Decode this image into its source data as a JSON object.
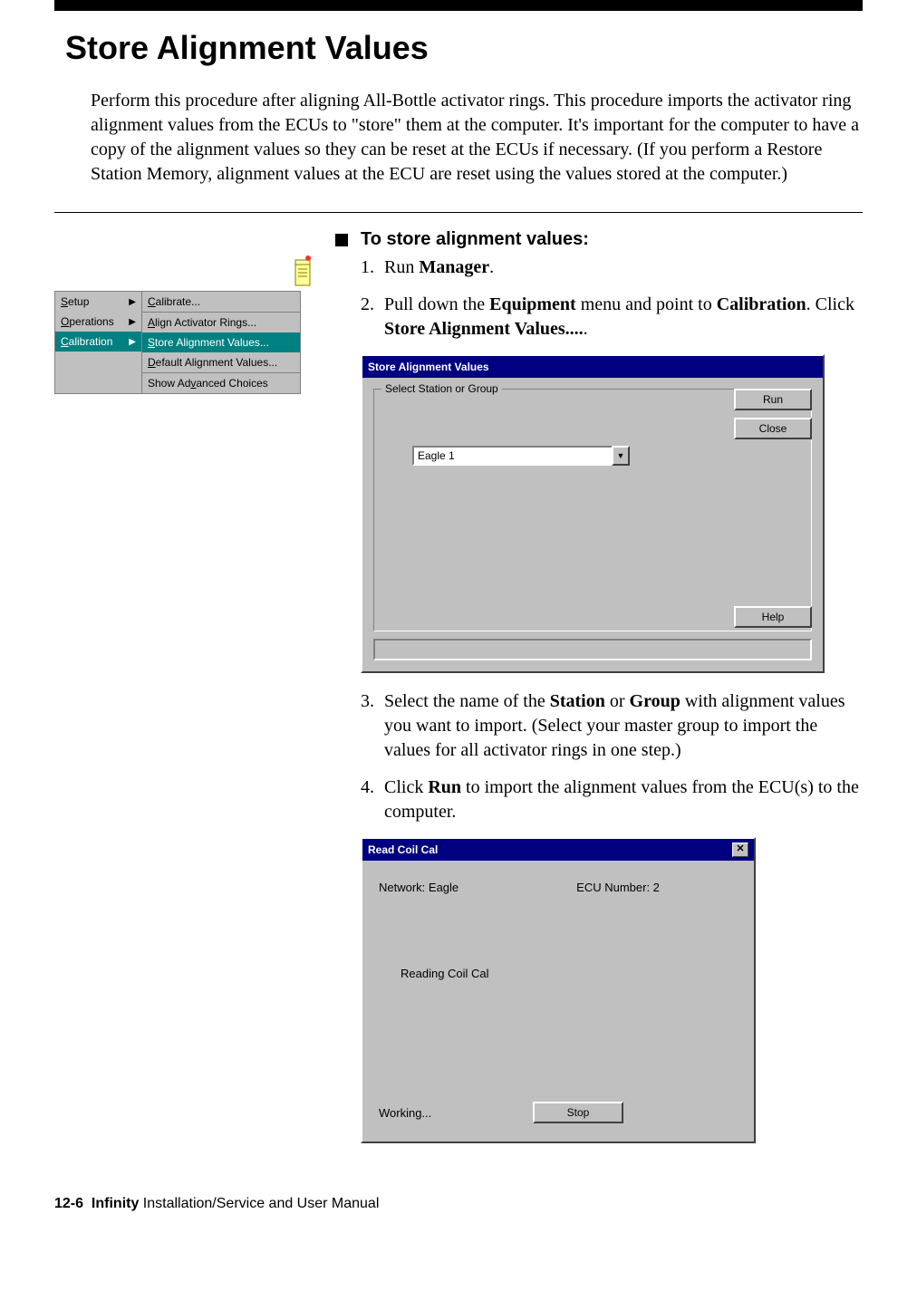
{
  "heading": "Store Alignment Values",
  "intro": "Perform this procedure after aligning All-Bottle activator rings. This procedure imports the activator ring alignment values from the ECUs to \"store\" them at the computer. It's important for the computer to have a copy of the alignment values so they can be reset at the ECUs if necessary. (If you perform a Restore Station Memory, alignment values at the ECU are reset using the values stored at the computer.)",
  "sub_heading": "To store alignment values:",
  "steps": {
    "s1": {
      "num": "1.",
      "pre": "Run ",
      "b1": "Manager",
      "post": "."
    },
    "s2": {
      "num": "2.",
      "pre": "Pull down the ",
      "b1": "Equipment",
      "mid1": " menu and point to ",
      "b2": "Calibration",
      "mid2": ". Click ",
      "b3": "Store Alignment Values....",
      "post": "."
    },
    "s3": {
      "num": "3.",
      "pre": "Select the name of the ",
      "b1": "Station",
      "mid1": " or ",
      "b2": "Group",
      "post": " with alignment values you want to import. (Select your master group to import the values for all activator rings in one step.)"
    },
    "s4": {
      "num": "4.",
      "pre": "Click ",
      "b1": "Run",
      "post": " to import the alignment values from the ECU(s) to the computer."
    }
  },
  "menu": {
    "col1": {
      "setup": "Setup",
      "operations": "Operations",
      "calibration": "Calibration"
    },
    "col2": {
      "calibrate": "Calibrate...",
      "align": "Align Activator Rings...",
      "store": "Store Alignment Values...",
      "default": "Default Alignment Values...",
      "advanced": "Show Advanced Choices"
    }
  },
  "dialogA": {
    "title": "Store Alignment Values",
    "group_label": "Select Station or Group",
    "combo_value": "Eagle 1",
    "run": "Run",
    "close": "Close",
    "help": "Help"
  },
  "dialogB": {
    "title": "Read Coil Cal",
    "network_label": "Network: Eagle",
    "ecu_label": "ECU Number: 2",
    "reading": "Reading Coil Cal",
    "working": "Working...",
    "stop": "Stop"
  },
  "footer": {
    "page": "12-6",
    "title_bold": "Infinity",
    "title_rest": " Installation/Service and User Manual"
  }
}
